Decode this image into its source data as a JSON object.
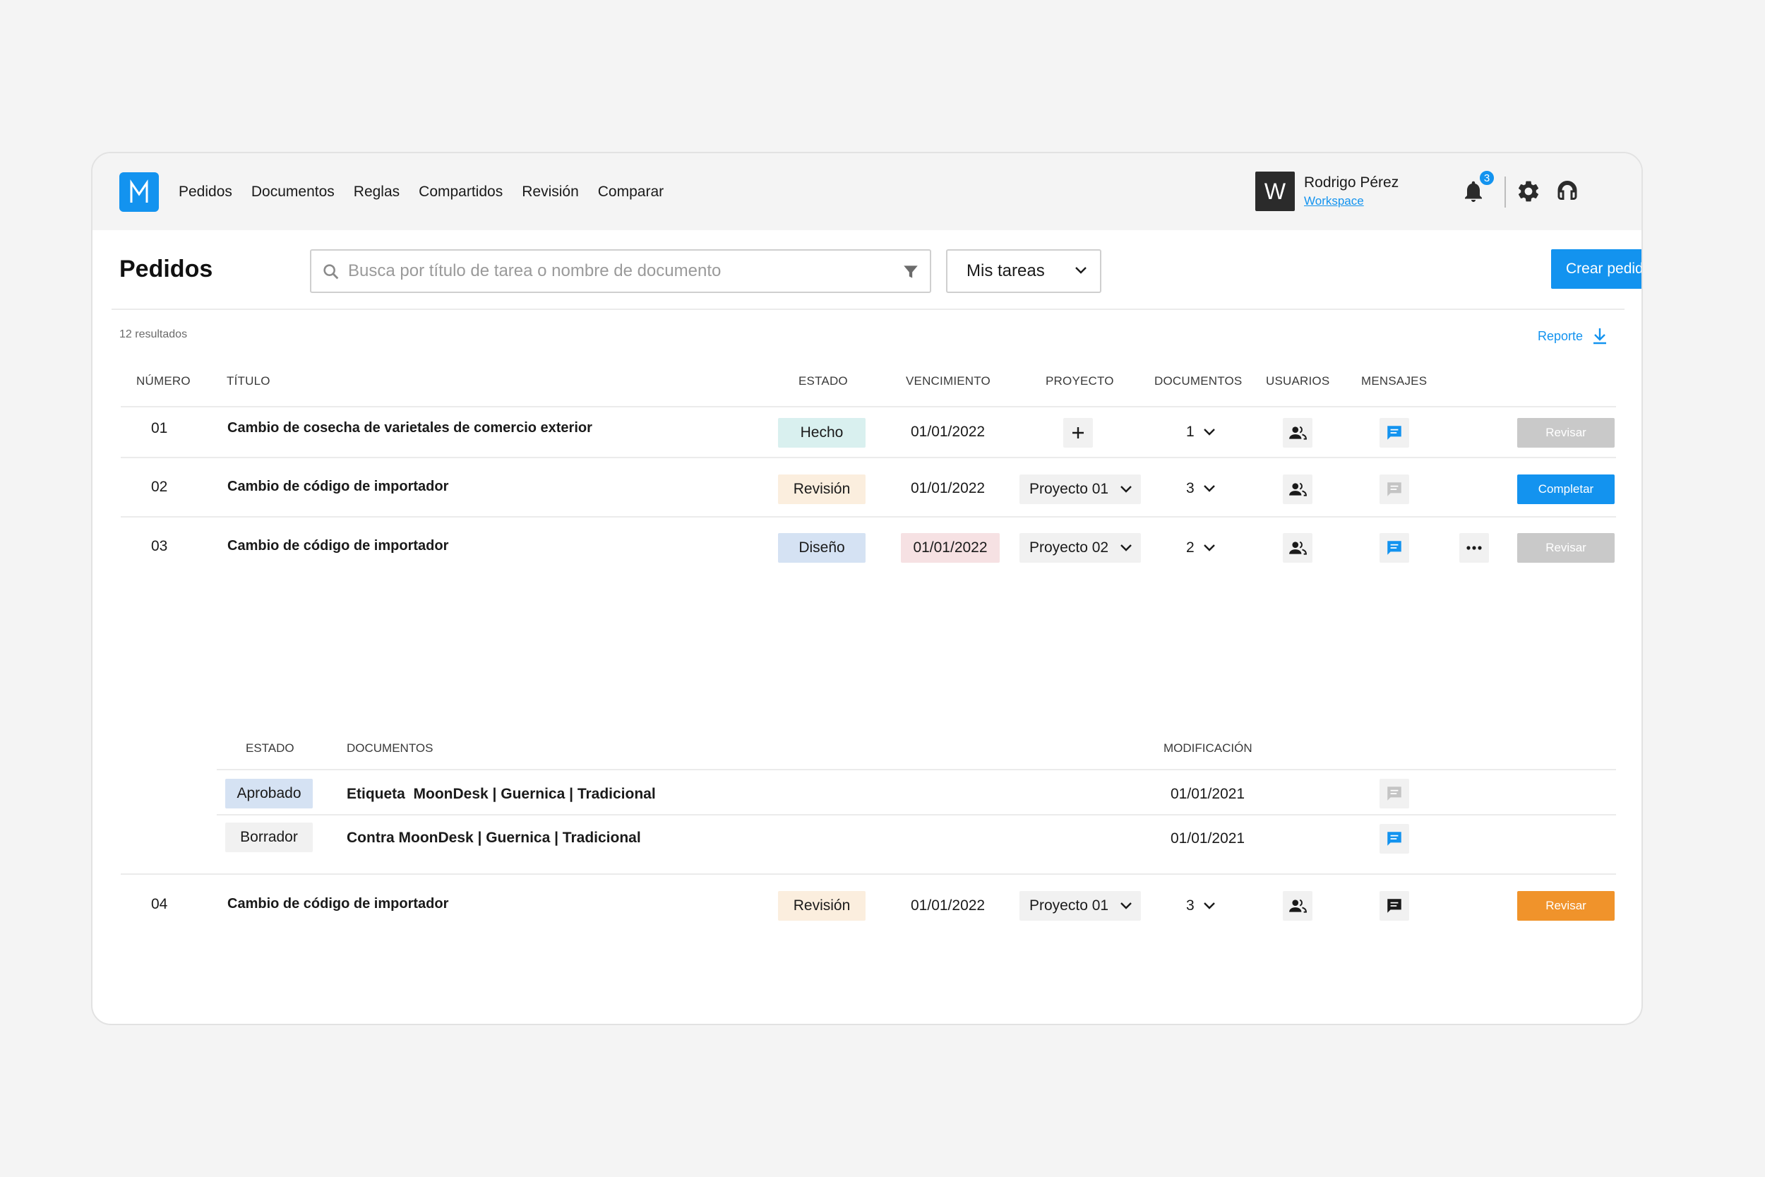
{
  "brand": {
    "logo_letter": "M",
    "accent": "#1393ef"
  },
  "nav": {
    "items": [
      "Pedidos",
      "Documentos",
      "Reglas",
      "Compartidos",
      "Revisión",
      "Comparar"
    ]
  },
  "user": {
    "avatar_letter": "W",
    "name": "Rodrigo Pérez",
    "workspace": "Workspace",
    "notifications": "3"
  },
  "page": {
    "title": "Pedidos",
    "search_placeholder": "Busca por título de tarea o nombre de documento",
    "filter_select": "Mis tareas",
    "create_button": "Crear pedido",
    "results": "12 resultados",
    "report": "Reporte"
  },
  "table": {
    "headers": [
      "NÚMERO",
      "TÍTULO",
      "ESTADO",
      "VENCIMIENTO",
      "PROYECTO",
      "DOCUMENTOS",
      "USUARIOS",
      "MENSAJES"
    ],
    "rows": [
      {
        "number": "01",
        "title": "Cambio de cosecha de varietales de comercio exterior",
        "status": "Hecho",
        "due": "01/01/2022",
        "project": "",
        "documents": "1",
        "action": "Revisar"
      },
      {
        "number": "02",
        "title": "Cambio de código de importador",
        "status": "Revisión",
        "due": "01/01/2022",
        "project": "Proyecto 01",
        "documents": "3",
        "action": "Completar"
      },
      {
        "number": "03",
        "title": "Cambio de código de importador",
        "status": "Diseño",
        "due": "01/01/2022",
        "project": "Proyecto 02",
        "documents": "2",
        "action": "Revisar"
      },
      {
        "number": "04",
        "title": "Cambio de código de importador",
        "status": "Revisión",
        "due": "01/01/2022",
        "project": "Proyecto 01",
        "documents": "3",
        "action": "Revisar"
      }
    ],
    "expanded": {
      "headers": [
        "ESTADO",
        "DOCUMENTOS",
        "MODIFICACIÓN"
      ],
      "rows": [
        {
          "status": "Aprobado",
          "document": "Etiqueta  MoonDesk | Guernica | Tradicional",
          "modified": "01/01/2021"
        },
        {
          "status": "Borrador",
          "document": "Contra MoonDesk | Guernica | Tradicional",
          "modified": "01/01/2021"
        }
      ]
    }
  },
  "colors": {
    "status_hecho": "#d9f0ef",
    "status_revision": "#fbeede",
    "status_diseno": "#d5e2f3",
    "status_aprobado": "#d5e2f3",
    "status_borrador": "#f1f1f1",
    "btn_disabled": "#c9c9c9",
    "btn_complete": "#1393ef",
    "btn_review": "#f0932b"
  }
}
